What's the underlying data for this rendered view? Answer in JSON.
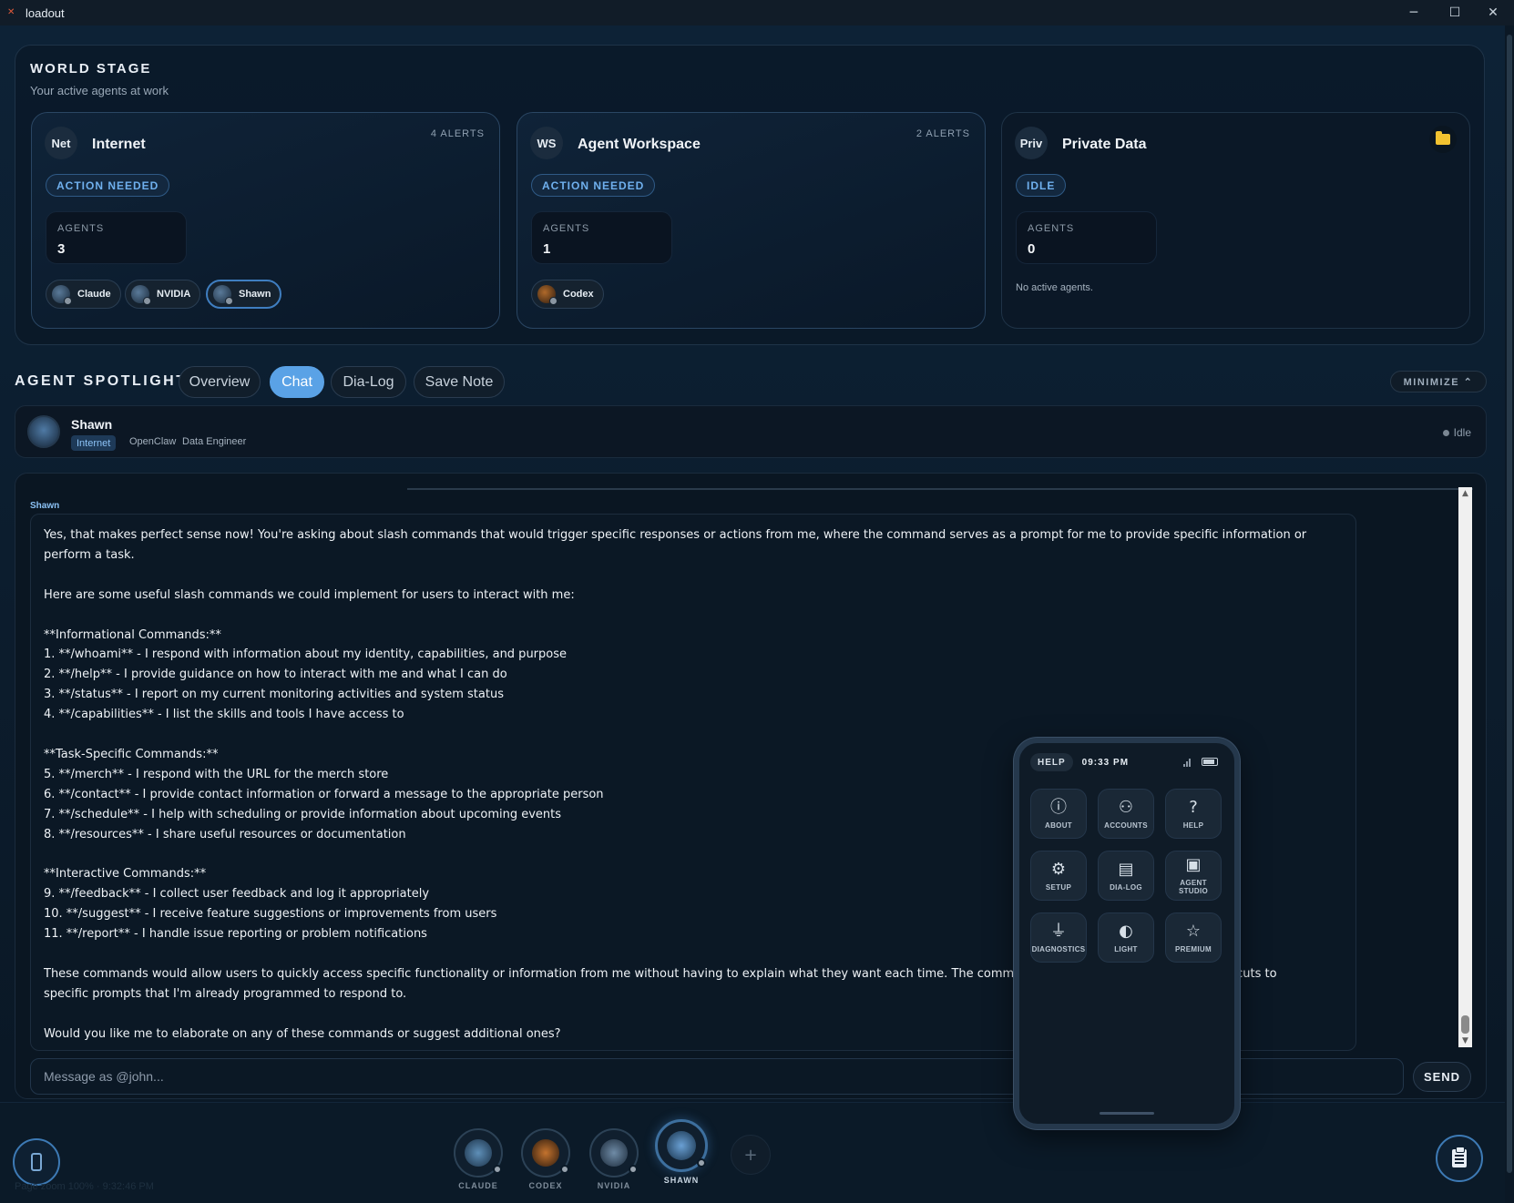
{
  "window": {
    "title": "loadout",
    "minimize_glyph": "─",
    "maximize_glyph": "☐",
    "close_glyph": "✕"
  },
  "world_stage": {
    "title": "WORLD STAGE",
    "subtitle": "Your active agents at work",
    "zones": [
      {
        "abbr": "Net",
        "name": "Internet",
        "alerts": "4 ALERTS",
        "status": "ACTION NEEDED",
        "agents_label": "AGENTS",
        "agents_count": "3",
        "agents": [
          {
            "name": "Claude"
          },
          {
            "name": "NVIDIA"
          },
          {
            "name": "Shawn"
          }
        ]
      },
      {
        "abbr": "WS",
        "name": "Agent Workspace",
        "alerts": "2 ALERTS",
        "status": "ACTION NEEDED",
        "agents_label": "AGENTS",
        "agents_count": "1",
        "agents": [
          {
            "name": "Codex"
          }
        ]
      },
      {
        "abbr": "Priv",
        "name": "Private Data",
        "status": "IDLE",
        "agents_label": "AGENTS",
        "agents_count": "0",
        "empty_text": "No active agents.",
        "folder_icon": "folder-icon"
      }
    ]
  },
  "spotlight": {
    "title": "AGENT SPOTLIGHT",
    "tabs": [
      {
        "label": "Overview"
      },
      {
        "label": "Chat",
        "active": true
      },
      {
        "label": "Dia-Log"
      },
      {
        "label": "Save Note"
      }
    ],
    "minimize_label": "MINIMIZE ⌃",
    "agent": {
      "name": "Shawn",
      "zone_tag": "Internet",
      "platform": "OpenClaw",
      "role": "Data Engineer",
      "status": "Idle"
    }
  },
  "chat": {
    "sender": "Shawn",
    "message": "Yes, that makes perfect sense now! You're asking about slash commands that would trigger specific responses or actions from me, where the command serves as a prompt for me to provide specific information or perform a task.\n\nHere are some useful slash commands we could implement for users to interact with me:\n\n**Informational Commands:**\n1. **/whoami** - I respond with information about my identity, capabilities, and purpose\n2. **/help** - I provide guidance on how to interact with me and what I can do\n3. **/status** - I report on my current monitoring activities and system status\n4. **/capabilities** - I list the skills and tools I have access to\n\n**Task-Specific Commands:**\n5. **/merch** - I respond with the URL for the merch store\n6. **/contact** - I provide contact information or forward a message to the appropriate person\n7. **/schedule** - I help with scheduling or provide information about upcoming events\n8. **/resources** - I share useful resources or documentation\n\n**Interactive Commands:**\n9. **/feedback** - I collect user feedback and log it appropriately\n10. **/suggest** - I receive feature suggestions or improvements from users\n11. **/report** - I handle issue reporting or problem notifications\n\nThese commands would allow users to quickly access specific functionality or information from me without having to explain what they want each time. The commands would essentially serve as shortcuts to specific prompts that I'm already programmed to respond to.\n\nWould you like me to elaborate on any of these commands or suggest additional ones?",
    "input_placeholder": "Message as @john...",
    "send_label": "SEND"
  },
  "phone": {
    "help_label": "HELP",
    "time": "09:33 PM",
    "tiles": [
      {
        "label": "ABOUT",
        "icon": "info-icon",
        "glyph": "ⓘ"
      },
      {
        "label": "ACCOUNTS",
        "icon": "user-icon",
        "glyph": "⚇"
      },
      {
        "label": "HELP",
        "icon": "question-icon",
        "glyph": "?"
      },
      {
        "label": "SETUP",
        "icon": "gear-icon",
        "glyph": "⚙"
      },
      {
        "label": "DIA-LOG",
        "icon": "document-icon",
        "glyph": "▤"
      },
      {
        "label": "AGENT STUDIO",
        "icon": "chip-icon",
        "glyph": "▣"
      },
      {
        "label": "DIAGNOSTICS",
        "icon": "plug-icon",
        "glyph": "⏚"
      },
      {
        "label": "LIGHT",
        "icon": "theme-icon",
        "glyph": "◐"
      },
      {
        "label": "PREMIUM",
        "icon": "star-icon",
        "glyph": "☆"
      }
    ]
  },
  "dock": {
    "agents": [
      {
        "label": "CLAUDE"
      },
      {
        "label": "CODEX"
      },
      {
        "label": "NVIDIA"
      },
      {
        "label": "SHAWN",
        "active": true
      }
    ],
    "add_label": "+",
    "footer": "Page zoom 100% · 9:32:46 PM"
  },
  "colors": {
    "accent": "#5aa2e6",
    "status_action": "#6fb0ee",
    "folder": "#f2c230",
    "background": "#0b1825"
  }
}
